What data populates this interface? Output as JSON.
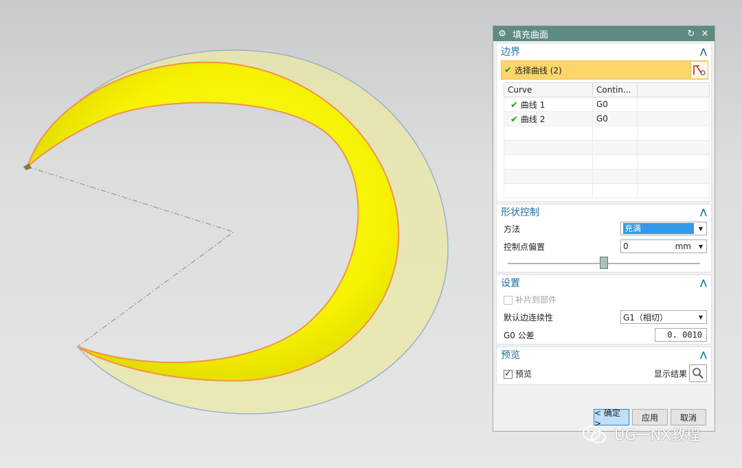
{
  "dialog": {
    "title": "填充曲面",
    "icons": {
      "settings": "gear-icon",
      "reset": "reset-icon",
      "close": "close-icon"
    }
  },
  "boundary": {
    "title": "边界",
    "select_label": "选择曲线 (2)",
    "table": {
      "headers": [
        "Curve",
        "Contin..."
      ],
      "rows": [
        {
          "name": "曲线 1",
          "cont": "G0"
        },
        {
          "name": "曲线 2",
          "cont": "G0"
        }
      ]
    }
  },
  "shape": {
    "title": "形状控制",
    "method_label": "方法",
    "method_value": "充满",
    "offset_label": "控制点偏置",
    "offset_value": "0",
    "offset_unit": "mm",
    "slider_level": 0.5
  },
  "settings": {
    "title": "设置",
    "patch_label": "补片到部件",
    "patch_checked": false,
    "continuity_label": "默认边连续性",
    "continuity_value": "G1（相切）",
    "tolerance_label": "G0 公差",
    "tolerance_value": "0. 0010"
  },
  "preview": {
    "title": "预览",
    "preview_label": "预览",
    "preview_checked": true,
    "show_result_label": "显示结果"
  },
  "buttons": {
    "ok": "< 确定 >",
    "apply": "应用",
    "cancel": "取消"
  },
  "watermark": "UG一NX教程",
  "colors": {
    "titlebar": "#5e8a82",
    "section_title": "#1f6fa3",
    "selection_highlight": "#fcd56b",
    "fill_surface": "#ffff00",
    "boundary_curve": "#f2924c"
  }
}
